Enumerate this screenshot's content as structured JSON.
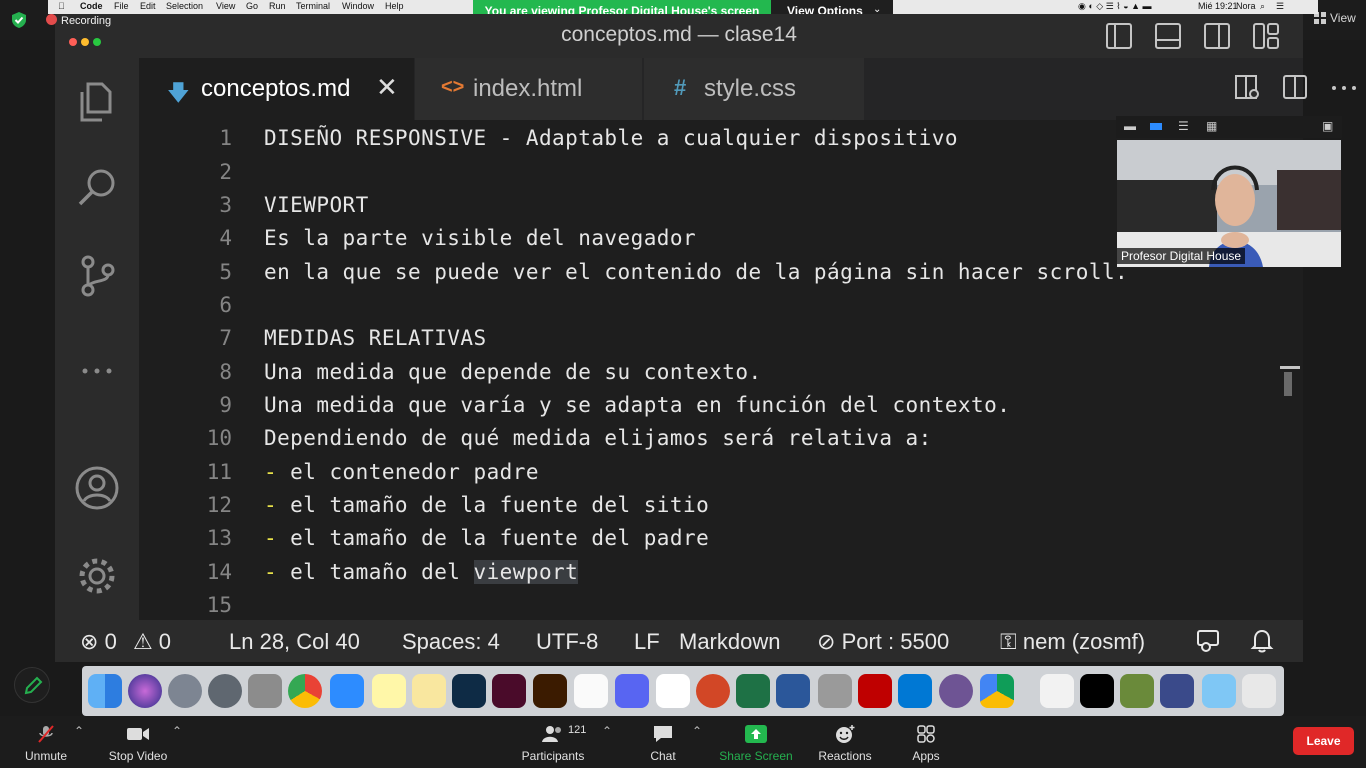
{
  "zoom": {
    "recording_label": "Recording",
    "sharing_banner": "You are viewing Profesor Digital House's screen",
    "view_options": "View Options",
    "view_label": "View",
    "participant_name": "Profesor Digital House",
    "participants_count": "121",
    "toolbar": {
      "unmute": "Unmute",
      "stop_video": "Stop Video",
      "participants": "Participants",
      "chat": "Chat",
      "share_screen": "Share Screen",
      "reactions": "Reactions",
      "apps": "Apps",
      "leave": "Leave"
    },
    "colors": {
      "share_green": "#23b84f",
      "leave_red": "#e02828"
    }
  },
  "menubar": {
    "app": "Code",
    "items": [
      "File",
      "Edit",
      "Selection",
      "View",
      "Go",
      "Run",
      "Terminal",
      "Window",
      "Help"
    ],
    "clock": "Mié 19:21",
    "user": "Nora"
  },
  "vscode": {
    "window_title": "conceptos.md — clase14",
    "tabs": [
      {
        "label": "conceptos.md",
        "icon": "markdown-icon",
        "active": true
      },
      {
        "label": "index.html",
        "icon": "html-icon",
        "active": false
      },
      {
        "label": "style.css",
        "icon": "css-icon",
        "active": false
      }
    ],
    "lines": [
      {
        "n": "1",
        "text": "DISEÑO RESPONSIVE - Adaptable a cualquier dispositivo"
      },
      {
        "n": "2",
        "text": ""
      },
      {
        "n": "3",
        "text": "VIEWPORT"
      },
      {
        "n": "4",
        "text": "Es la parte visible del navegador"
      },
      {
        "n": "5",
        "text": "en la que se puede ver el contenido de la página sin hacer scroll."
      },
      {
        "n": "6",
        "text": ""
      },
      {
        "n": "7",
        "text": "MEDIDAS RELATIVAS"
      },
      {
        "n": "8",
        "text": "Una medida que depende de su contexto."
      },
      {
        "n": "9",
        "text": "Una medida que varía y se adapta en función del contexto."
      },
      {
        "n": "10",
        "text": "Dependiendo de qué medida elijamos será relativa a:"
      },
      {
        "n": "11",
        "dash": "-",
        "text": " el contenedor padre"
      },
      {
        "n": "12",
        "dash": "-",
        "text": " el tamaño de la fuente del sitio"
      },
      {
        "n": "13",
        "dash": "-",
        "text": " el tamaño de la fuente del padre"
      },
      {
        "n": "14",
        "dash": "-",
        "text": " el tamaño del ",
        "selected": "viewport"
      },
      {
        "n": "15",
        "text": ""
      }
    ],
    "status": {
      "errors": "0",
      "warnings": "0",
      "position": "Ln 28, Col 40",
      "spaces": "Spaces: 4",
      "encoding": "UTF-8",
      "eol": "LF",
      "language": "Markdown",
      "port": "Port : 5500",
      "account": "nem (zosmf)"
    }
  }
}
